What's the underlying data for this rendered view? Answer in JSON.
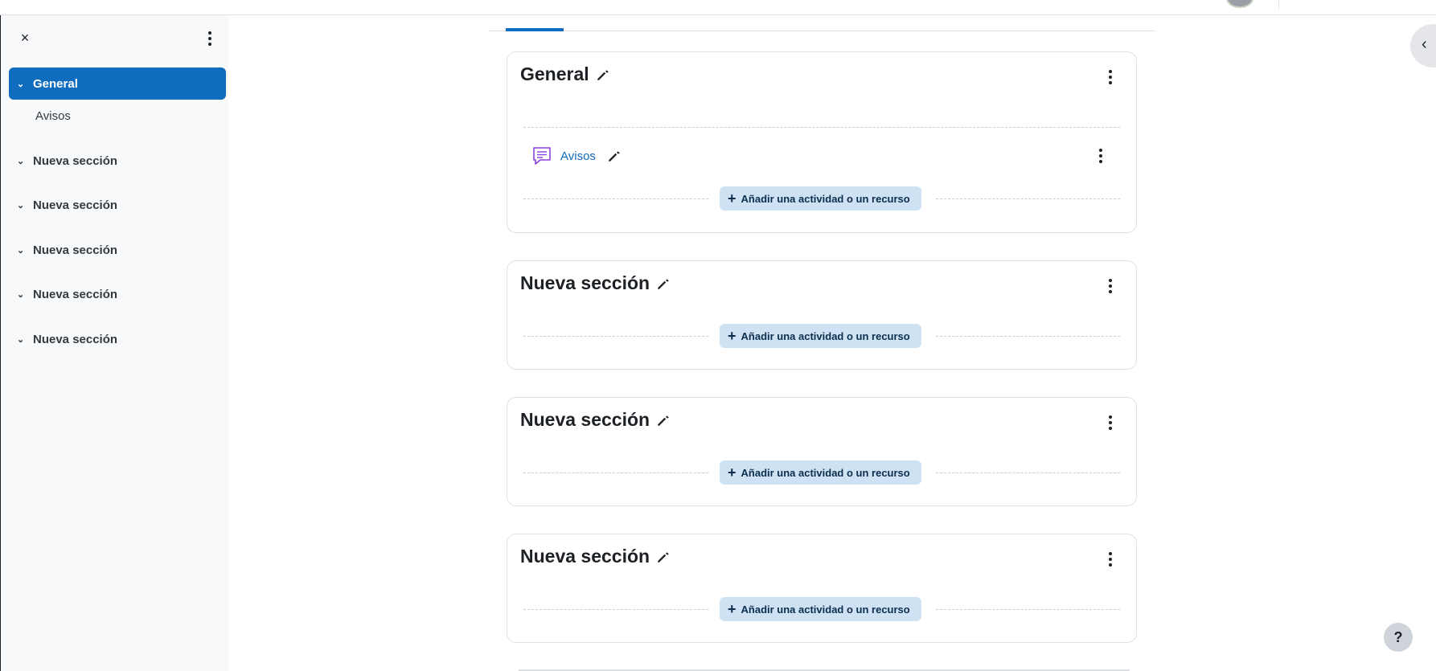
{
  "drawer": {
    "close_icon": "×",
    "items": [
      {
        "label": "General",
        "active": true
      },
      {
        "label": "Nueva sección"
      },
      {
        "label": "Nueva sección"
      },
      {
        "label": "Nueva sección"
      },
      {
        "label": "Nueva sección"
      },
      {
        "label": "Nueva sección"
      }
    ],
    "sub_items": [
      {
        "label": "Avisos"
      }
    ]
  },
  "sections": [
    {
      "title": "General",
      "activities": [
        {
          "name": "Avisos",
          "icon": "forum-icon"
        }
      ],
      "add_label": "Añadir una actividad o un recurso"
    },
    {
      "title": "Nueva sección",
      "add_label": "Añadir una actividad o un recurso"
    },
    {
      "title": "Nueva sección",
      "add_label": "Añadir una actividad o un recurso"
    },
    {
      "title": "Nueva sección",
      "add_label": "Añadir una actividad o un recurso"
    }
  ],
  "help": {
    "label": "?"
  },
  "colors": {
    "primary": "#0f6cbf",
    "add_button_bg": "#cfe2f3",
    "drawer_bg": "#f8f9fa",
    "forum_icon": "#8a3fe0"
  }
}
